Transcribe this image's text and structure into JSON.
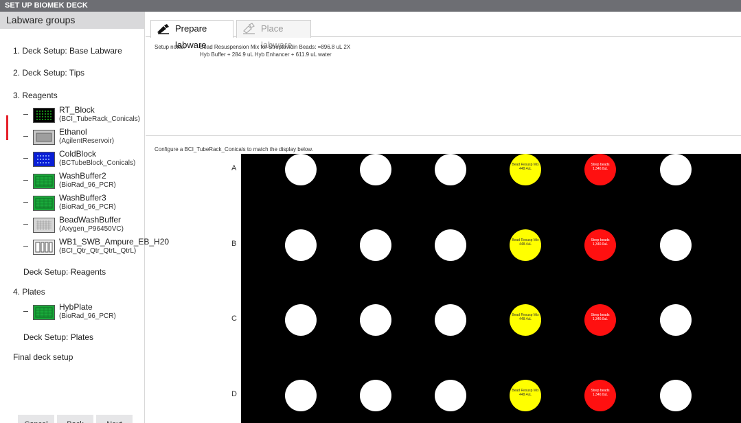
{
  "window": {
    "title": "SET UP BIOMEK DECK"
  },
  "sidebar": {
    "header": "Labware groups",
    "groups": [
      {
        "label": "1. Deck Setup: Base Labware"
      },
      {
        "label": "2. Deck Setup: Tips"
      },
      {
        "label": "3. Reagents"
      }
    ],
    "reagents": [
      {
        "name": "RT_Block",
        "type": "(BCI_TubeRack_Conicals)",
        "thumb": "black-tube-rack-icon",
        "active": true
      },
      {
        "name": "Ethanol",
        "type": "(AgilentReservoir)",
        "thumb": "gray-reservoir-icon"
      },
      {
        "name": "ColdBlock",
        "type": "(BCTubeBlock_Conicals)",
        "thumb": "blue-tube-block-icon"
      },
      {
        "name": "WashBuffer2",
        "type": "(BioRad_96_PCR)",
        "thumb": "green-plate-icon"
      },
      {
        "name": "WashBuffer3",
        "type": "(BioRad_96_PCR)",
        "thumb": "green-plate-icon"
      },
      {
        "name": "BeadWashBuffer",
        "type": "(Axygen_P96450VC)",
        "thumb": "gray-plate-icon"
      },
      {
        "name": "WB1_SWB_Ampure_EB_H20",
        "type": "(BCI_Qtr_Qtr_QtrL_QtrL)",
        "thumb": "quarter-reservoir-icon"
      }
    ],
    "deck_setup_reagents": "Deck Setup: Reagents",
    "plates_group": "4. Plates",
    "plates": [
      {
        "name": "HybPlate",
        "type": "(BioRad_96_PCR)",
        "thumb": "green-plate-icon"
      }
    ],
    "deck_setup_plates": "Deck Setup: Plates",
    "final": "Final deck setup",
    "buttons": {
      "cancel": "Cancel",
      "back": "Back",
      "next": "Next"
    }
  },
  "tabs": {
    "prepare": "Prepare labware",
    "place": "Place labware"
  },
  "notes": {
    "label": "Setup notes:",
    "text": "Bead Resuspension Mix for Streptavidin Beads: =896.8 uL 2X Hyb  Buffer + 284.9 uL Hyb Enhancer + 611.9 uL water"
  },
  "config_line": "Configure a BCI_TubeRack_Conicals to match the display below.",
  "rack": {
    "rows": [
      "A",
      "B",
      "C",
      "D"
    ],
    "colors": {
      "empty": "#ffffff",
      "bead": "#ffff00",
      "strep": "#ff1010",
      "background": "#000000"
    },
    "wells": [
      [
        {
          "type": "empty"
        },
        {
          "type": "empty"
        },
        {
          "type": "empty"
        },
        {
          "type": "bead",
          "name": "Bead Resusp Mix",
          "vol": "448.4uL"
        },
        {
          "type": "strep",
          "name": "Strep beads",
          "vol": "1,340.0uL"
        },
        {
          "type": "empty"
        }
      ],
      [
        {
          "type": "empty"
        },
        {
          "type": "empty"
        },
        {
          "type": "empty"
        },
        {
          "type": "bead",
          "name": "Bead Resusp Mix",
          "vol": "448.4uL"
        },
        {
          "type": "strep",
          "name": "Strep beads",
          "vol": "1,340.0uL"
        },
        {
          "type": "empty"
        }
      ],
      [
        {
          "type": "empty"
        },
        {
          "type": "empty"
        },
        {
          "type": "empty"
        },
        {
          "type": "bead",
          "name": "Bead Resusp Mix",
          "vol": "448.4uL"
        },
        {
          "type": "strep",
          "name": "Strep beads",
          "vol": "1,340.0uL"
        },
        {
          "type": "empty"
        }
      ],
      [
        {
          "type": "empty"
        },
        {
          "type": "empty"
        },
        {
          "type": "empty"
        },
        {
          "type": "bead",
          "name": "Bead Resusp Mix",
          "vol": "448.4uL"
        },
        {
          "type": "strep",
          "name": "Strep beads",
          "vol": "1,340.0uL"
        },
        {
          "type": "empty"
        }
      ]
    ]
  }
}
